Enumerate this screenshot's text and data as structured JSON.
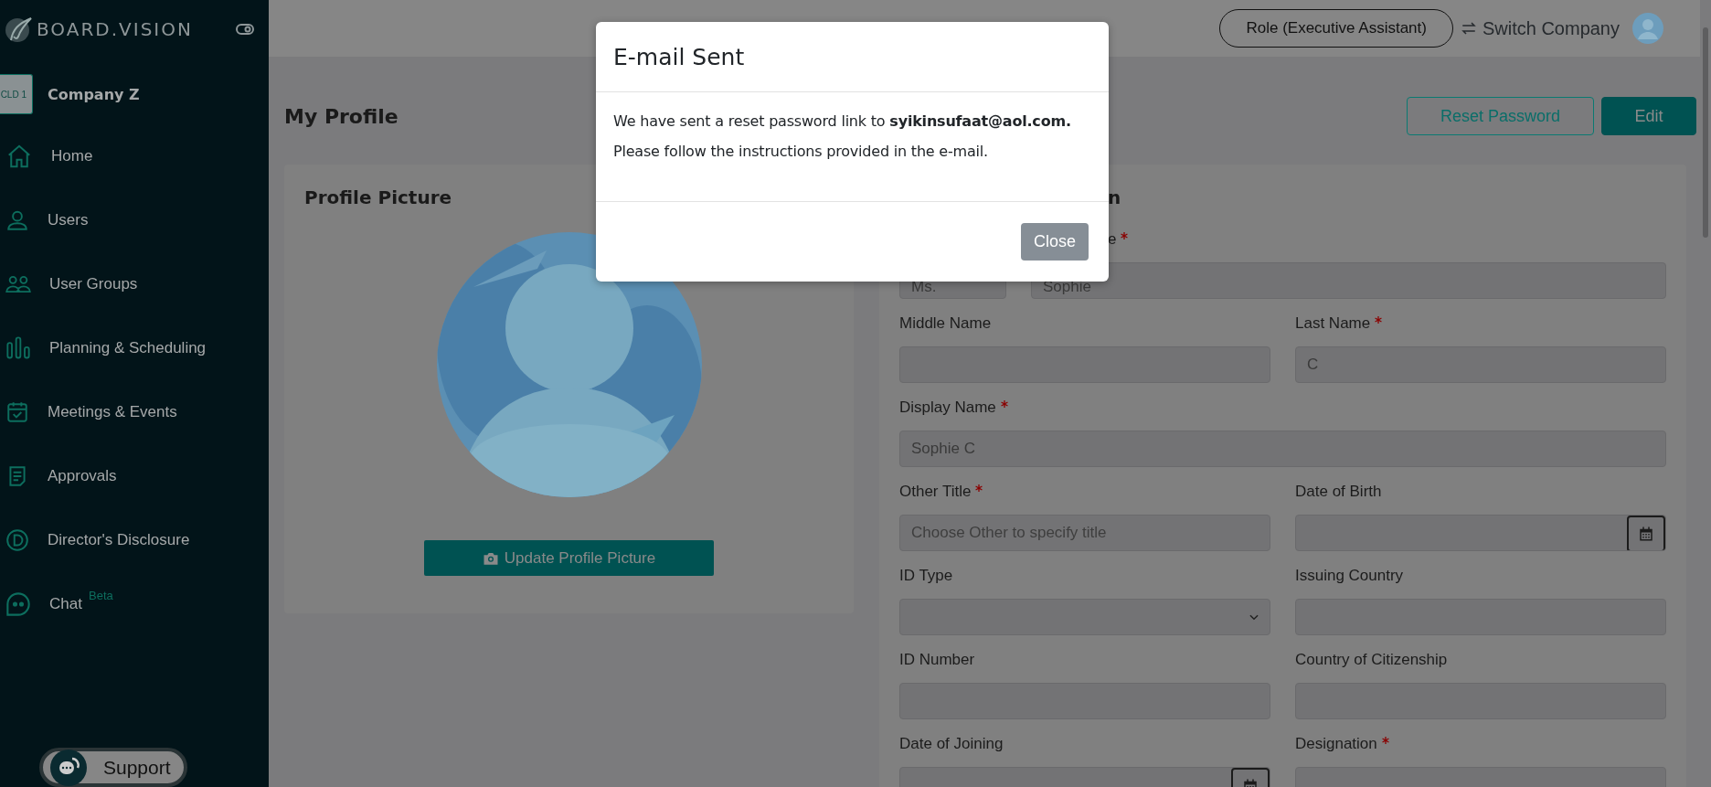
{
  "sidebar": {
    "brand": "BOARD.VISION",
    "company": {
      "badge": "CLD 1",
      "name": "Company Z"
    },
    "items": [
      {
        "label": "Home"
      },
      {
        "label": "Users"
      },
      {
        "label": "User Groups"
      },
      {
        "label": "Planning & Scheduling"
      },
      {
        "label": "Meetings & Events"
      },
      {
        "label": "Approvals"
      },
      {
        "label": "Director's Disclosure"
      },
      {
        "label": "Chat",
        "badge": "Beta"
      }
    ],
    "support": "Support"
  },
  "header": {
    "role": "Role (Executive Assistant)",
    "switch": "Switch Company"
  },
  "page": {
    "title": "My Profile",
    "actions": [
      {
        "label": "Reset Password",
        "kind": "outline"
      },
      {
        "label": "Edit",
        "kind": "solid"
      }
    ]
  },
  "profile_card": {
    "title": "Profile Picture",
    "button": "Update Profile Picture"
  },
  "form": {
    "heading": "n",
    "name_row": {
      "title": {
        "value": "Ms."
      },
      "first_name": {
        "label": "e",
        "required": true,
        "value": "Sophie"
      }
    },
    "fields": [
      {
        "label": "Middle Name",
        "required": false,
        "kind": "text"
      },
      {
        "label": "Last Name",
        "required": true,
        "kind": "text",
        "value": "C"
      },
      {
        "label": "Display Name",
        "required": true,
        "kind": "text",
        "value": "Sophie C",
        "wide": true
      },
      {
        "label": "Other Title",
        "required": true,
        "kind": "text",
        "placeholder": "Choose Other to specify title"
      },
      {
        "label": "Date of Birth",
        "required": false,
        "kind": "date"
      },
      {
        "label": "ID Type",
        "required": false,
        "kind": "select"
      },
      {
        "label": "Issuing Country",
        "required": false,
        "kind": "text"
      },
      {
        "label": "ID Number",
        "required": false,
        "kind": "text"
      },
      {
        "label": "Country of Citizenship",
        "required": false,
        "kind": "text"
      },
      {
        "label": "Date of Joining",
        "required": false,
        "kind": "date"
      },
      {
        "label": "Designation",
        "required": true,
        "kind": "text"
      }
    ]
  },
  "modal": {
    "title": "E-mail Sent",
    "lines": [
      "We have sent a reset password link to **syikinsufaat@aol.com.**",
      "Please follow the instructions provided in the e-mail."
    ],
    "button": "Close"
  }
}
